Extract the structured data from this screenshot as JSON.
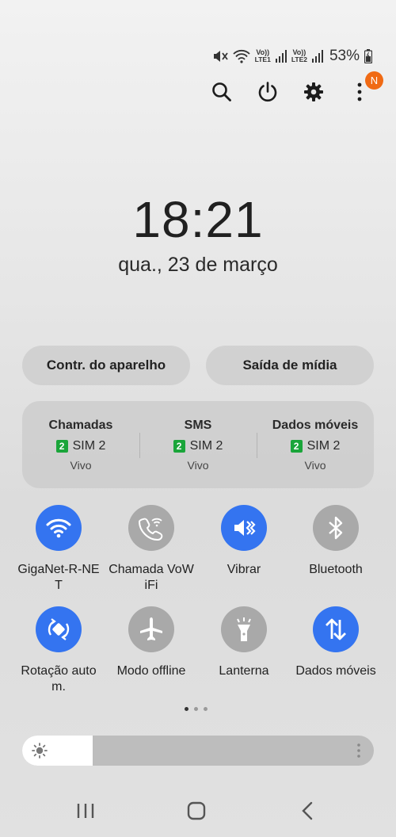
{
  "statusbar": {
    "icons": [
      "mute-icon",
      "wifi-calling-icon",
      "volte-lte1-icon",
      "signal-icon",
      "volte-lte2-icon",
      "signal-icon",
      "battery-icon"
    ],
    "volte1": {
      "top": "Vo))",
      "bottom": "LTE1"
    },
    "volte2": {
      "top": "Vo))",
      "bottom": "LTE2"
    },
    "battery_percent": "53%"
  },
  "top_actions": {
    "icons": [
      "search-icon",
      "power-icon",
      "gear-icon",
      "more-vertical-icon"
    ],
    "notification_badge": "N"
  },
  "lockinfo": {
    "time": "18:21",
    "date": "qua., 23 de março"
  },
  "pills": {
    "device_control": "Contr. do aparelho",
    "media_output": "Saída de mídia"
  },
  "sim": {
    "columns": [
      {
        "title": "Chamadas",
        "badge": "2",
        "sim": "SIM 2",
        "carrier": "Vivo"
      },
      {
        "title": "SMS",
        "badge": "2",
        "sim": "SIM 2",
        "carrier": "Vivo"
      },
      {
        "title": "Dados móveis",
        "badge": "2",
        "sim": "SIM 2",
        "carrier": "Vivo"
      }
    ]
  },
  "tiles": [
    {
      "label": "GigaNet-R-NET",
      "icon": "wifi-icon",
      "active": true
    },
    {
      "label": "Chamada VoWiFi",
      "icon": "wifi-calling-icon",
      "active": false
    },
    {
      "label": "Vibrar",
      "icon": "vibrate-icon",
      "active": true
    },
    {
      "label": "Bluetooth",
      "icon": "bluetooth-icon",
      "active": false
    },
    {
      "label": "Rotação autom.",
      "icon": "auto-rotate-icon",
      "active": true
    },
    {
      "label": "Modo offline",
      "icon": "airplane-icon",
      "active": false
    },
    {
      "label": "Lanterna",
      "icon": "flashlight-icon",
      "active": false
    },
    {
      "label": "Dados móveis",
      "icon": "mobile-data-icon",
      "active": true
    }
  ],
  "pager": {
    "pages": 3,
    "current": 1
  },
  "brightness": {
    "level": 0.2
  },
  "navbar": {
    "icons": [
      "recents-icon",
      "home-icon",
      "back-icon"
    ]
  },
  "colors": {
    "accent": "#3474f0",
    "tile_off": "#a9a9a9",
    "badge": "#f06a14",
    "sim_badge": "#1aa53a"
  }
}
